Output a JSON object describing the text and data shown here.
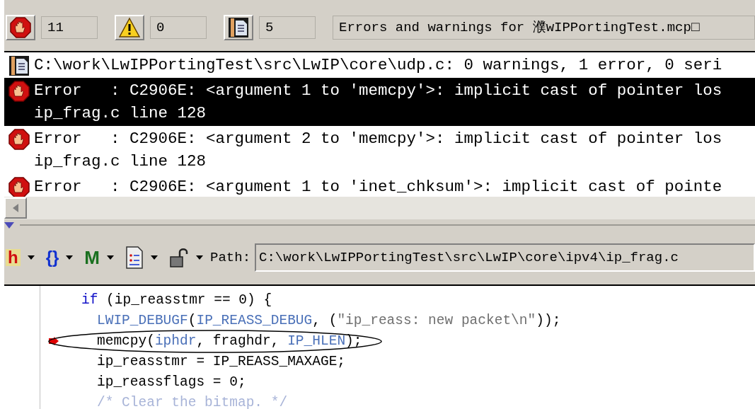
{
  "message_toolbar": {
    "filters": [
      {
        "kind": "error",
        "count": "11"
      },
      {
        "kind": "warning",
        "count": "0"
      },
      {
        "kind": "info",
        "count": "5"
      }
    ],
    "title": "Errors and warnings for 濮wIPPortingTest.mcp□"
  },
  "messages": [
    {
      "kind": "info",
      "selected": false,
      "lines": [
        "C:\\work\\LwIPPortingTest\\src\\LwIP\\core\\udp.c: 0 warnings, 1 error, 0 seri"
      ]
    },
    {
      "kind": "error",
      "selected": true,
      "lines": [
        "Error   : C2906E: <argument 1 to 'memcpy'>: implicit cast of pointer los",
        "ip_frag.c line 128"
      ]
    },
    {
      "kind": "error",
      "selected": false,
      "lines": [
        "Error   : C2906E: <argument 2 to 'memcpy'>: implicit cast of pointer los",
        "ip_frag.c line 128"
      ]
    },
    {
      "kind": "error",
      "selected": false,
      "lines": [
        "Error   : C2906E: <argument 1 to 'inet_chksum'>: implicit cast of pointe"
      ]
    }
  ],
  "editor_toolbar": {
    "menus": [
      {
        "kind": "header",
        "label": "h"
      },
      {
        "kind": "functions",
        "label": "{}"
      },
      {
        "kind": "markers",
        "label": "M"
      },
      {
        "kind": "document"
      },
      {
        "kind": "lock"
      }
    ],
    "path_label": "Path:",
    "path": "C:\\work\\LwIPPortingTest\\src\\LwIP\\core\\ipv4\\ip_frag.c"
  },
  "code": [
    {
      "tokens": [
        {
          "kind": "keyword",
          "text": "if"
        },
        {
          "kind": "plain",
          "text": " (ip_reasstmr == 0) {"
        }
      ],
      "children": [
        {
          "tokens": [
            {
              "kind": "macro",
              "text": "LWIP_DEBUGF"
            },
            {
              "kind": "plain",
              "text": "("
            },
            {
              "kind": "macro",
              "text": "IP_REASS_DEBUG"
            },
            {
              "kind": "plain",
              "text": ", ("
            },
            {
              "kind": "string",
              "text": "\"ip_reass: new packet\\n\""
            },
            {
              "kind": "plain",
              "text": "));"
            }
          ]
        },
        {
          "breakpoint": true,
          "circled": true,
          "tokens": [
            {
              "kind": "plain",
              "text": "memcpy("
            },
            {
              "kind": "macro",
              "text": "iphdr"
            },
            {
              "kind": "plain",
              "text": ", fraghdr, "
            },
            {
              "kind": "macro",
              "text": "IP_HLEN"
            },
            {
              "kind": "plain",
              "text": ");"
            }
          ]
        },
        {
          "tokens": [
            {
              "kind": "plain",
              "text": "ip_reasstmr = IP_REASS_MAXAGE;"
            }
          ]
        },
        {
          "tokens": [
            {
              "kind": "plain",
              "text": "ip_reassflags = 0;"
            }
          ]
        },
        {
          "tokens": [
            {
              "kind": "comment",
              "text": "/* Clear the bitmap. */"
            }
          ]
        }
      ]
    }
  ]
}
